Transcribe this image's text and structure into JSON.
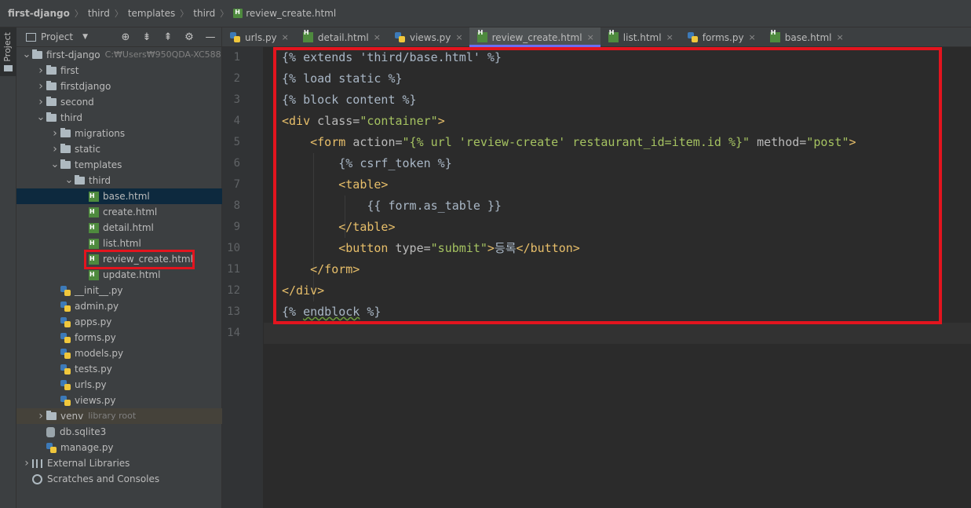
{
  "breadcrumb": [
    "first-django",
    "third",
    "templates",
    "third",
    "review_create.html"
  ],
  "left_strip": {
    "label": "Project"
  },
  "project_panel": {
    "title": "Project",
    "tools": [
      "target-icon",
      "expand-icon",
      "collapse-icon",
      "gear-icon",
      "minimize-icon"
    ],
    "tree": [
      {
        "label": "first-django",
        "hint": "C:₩Users₩950QDA-XC588",
        "kind": "folder",
        "depth": 0,
        "open": true
      },
      {
        "label": "first",
        "kind": "folder",
        "depth": 1,
        "open": false
      },
      {
        "label": "firstdjango",
        "kind": "folder",
        "depth": 1,
        "open": false
      },
      {
        "label": "second",
        "kind": "folder",
        "depth": 1,
        "open": false
      },
      {
        "label": "third",
        "kind": "folder",
        "depth": 1,
        "open": true
      },
      {
        "label": "migrations",
        "kind": "folder",
        "depth": 2,
        "open": false
      },
      {
        "label": "static",
        "kind": "folder",
        "depth": 2,
        "open": false
      },
      {
        "label": "templates",
        "kind": "folder",
        "depth": 2,
        "open": true
      },
      {
        "label": "third",
        "kind": "folder",
        "depth": 3,
        "open": true
      },
      {
        "label": "base.html",
        "kind": "html",
        "depth": 4,
        "selected": true
      },
      {
        "label": "create.html",
        "kind": "html",
        "depth": 4
      },
      {
        "label": "detail.html",
        "kind": "html",
        "depth": 4
      },
      {
        "label": "list.html",
        "kind": "html",
        "depth": 4
      },
      {
        "label": "review_create.html",
        "kind": "html",
        "depth": 4,
        "highlighted": true
      },
      {
        "label": "update.html",
        "kind": "html",
        "depth": 4
      },
      {
        "label": "__init__.py",
        "kind": "py",
        "depth": 2
      },
      {
        "label": "admin.py",
        "kind": "py",
        "depth": 2
      },
      {
        "label": "apps.py",
        "kind": "py",
        "depth": 2
      },
      {
        "label": "forms.py",
        "kind": "py",
        "depth": 2
      },
      {
        "label": "models.py",
        "kind": "py",
        "depth": 2
      },
      {
        "label": "tests.py",
        "kind": "py",
        "depth": 2
      },
      {
        "label": "urls.py",
        "kind": "py",
        "depth": 2
      },
      {
        "label": "views.py",
        "kind": "py",
        "depth": 2
      },
      {
        "label": "venv",
        "hint": "library root",
        "kind": "folder",
        "depth": 1,
        "open": false,
        "venv": true
      },
      {
        "label": "db.sqlite3",
        "kind": "db",
        "depth": 1
      },
      {
        "label": "manage.py",
        "kind": "py",
        "depth": 1
      },
      {
        "label": "External Libraries",
        "kind": "lib",
        "depth": 0,
        "open": false
      },
      {
        "label": "Scratches and Consoles",
        "kind": "scratch",
        "depth": 0
      }
    ]
  },
  "tabs": [
    {
      "label": "urls.py",
      "kind": "py",
      "close": "×"
    },
    {
      "label": "detail.html",
      "kind": "html",
      "close": "×"
    },
    {
      "label": "views.py",
      "kind": "py",
      "close": "×"
    },
    {
      "label": "review_create.html",
      "kind": "html",
      "close": "×",
      "active": true
    },
    {
      "label": "list.html",
      "kind": "html",
      "close": "×"
    },
    {
      "label": "forms.py",
      "kind": "py",
      "close": "×"
    },
    {
      "label": "base.html",
      "kind": "html",
      "close": "×"
    }
  ],
  "editor": {
    "line_numbers": [
      "1",
      "2",
      "3",
      "4",
      "5",
      "6",
      "7",
      "8",
      "9",
      "10",
      "11",
      "12",
      "13",
      "14"
    ],
    "lines": [
      [
        {
          "t": "{% extends 'third/base.html' %}",
          "c": "tmpl"
        }
      ],
      [
        {
          "t": "{% load static %}",
          "c": "tmpl"
        }
      ],
      [
        {
          "t": "{% block content %}",
          "c": "tmpl"
        }
      ],
      [
        {
          "t": "<div ",
          "c": "tag"
        },
        {
          "t": "class=",
          "c": "attr"
        },
        {
          "t": "\"container\"",
          "c": "str"
        },
        {
          "t": ">",
          "c": "tag"
        }
      ],
      [
        {
          "t": "    ",
          "c": "txt"
        },
        {
          "t": "<form ",
          "c": "tag"
        },
        {
          "t": "action=",
          "c": "attr"
        },
        {
          "t": "\"{% url 'review-create' restaurant_id=item.id %}\"",
          "c": "str"
        },
        {
          "t": " method=",
          "c": "attr"
        },
        {
          "t": "\"post\"",
          "c": "str"
        },
        {
          "t": ">",
          "c": "tag"
        }
      ],
      [
        {
          "t": "        {% csrf_token %}",
          "c": "tmpl"
        }
      ],
      [
        {
          "t": "        ",
          "c": "txt"
        },
        {
          "t": "<table>",
          "c": "tag"
        }
      ],
      [
        {
          "t": "            {{ form.as_table }}",
          "c": "tmpl"
        }
      ],
      [
        {
          "t": "        ",
          "c": "txt"
        },
        {
          "t": "</table>",
          "c": "tag"
        }
      ],
      [
        {
          "t": "        ",
          "c": "txt"
        },
        {
          "t": "<button ",
          "c": "tag"
        },
        {
          "t": "type=",
          "c": "attr"
        },
        {
          "t": "\"submit\"",
          "c": "str"
        },
        {
          "t": ">",
          "c": "tag"
        },
        {
          "t": "등록",
          "c": "txt"
        },
        {
          "t": "</button>",
          "c": "tag"
        }
      ],
      [
        {
          "t": "    ",
          "c": "txt"
        },
        {
          "t": "</form>",
          "c": "tag"
        }
      ],
      [
        {
          "t": "</div>",
          "c": "tag"
        }
      ],
      [
        {
          "t": "{% ",
          "c": "tmpl"
        },
        {
          "t": "endblock",
          "c": "tmpl squiggle"
        },
        {
          "t": " %}",
          "c": "tmpl"
        }
      ],
      [
        {
          "t": "",
          "c": "txt"
        }
      ]
    ]
  }
}
